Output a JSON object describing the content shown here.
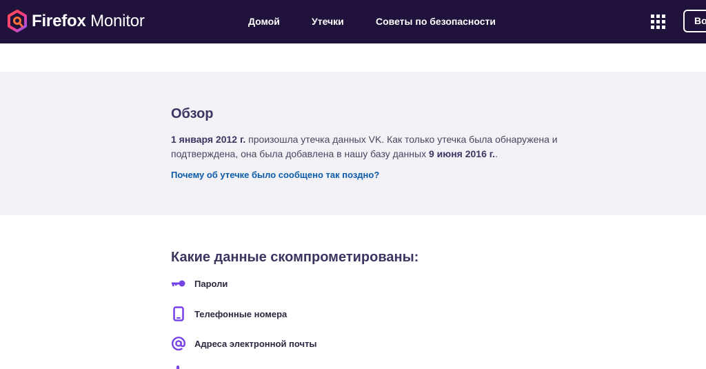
{
  "header": {
    "logo_bold": "Firefox",
    "logo_light": "Monitor",
    "nav": [
      {
        "label": "Домой"
      },
      {
        "label": "Утечки"
      },
      {
        "label": "Советы по безопасности"
      }
    ],
    "apps_icon": "grid-icon",
    "login_label": "Войти"
  },
  "overview": {
    "title": "Обзор",
    "date_breach": "1 января 2012 г.",
    "text_1": " произошла утечка данных VK. Как только утечка была обнаружена и подтверждена, она была добавлена в нашу базу данных ",
    "date_added": "9 июня 2016 г.",
    "text_2": ".",
    "why_link": "Почему об утечке было сообщено так поздно?"
  },
  "compromised": {
    "title": "Какие данные скомпрометированы:",
    "items": [
      {
        "icon": "key-icon",
        "label": "Пароли"
      },
      {
        "icon": "phone-icon",
        "label": "Телефонные номера"
      },
      {
        "icon": "at-icon",
        "label": "Адреса электронной почты"
      }
    ]
  },
  "colors": {
    "header_bg": "#20123a",
    "overview_bg": "#f2f1f6",
    "link": "#0b5ba8",
    "icon_accent": "#7542e5"
  }
}
